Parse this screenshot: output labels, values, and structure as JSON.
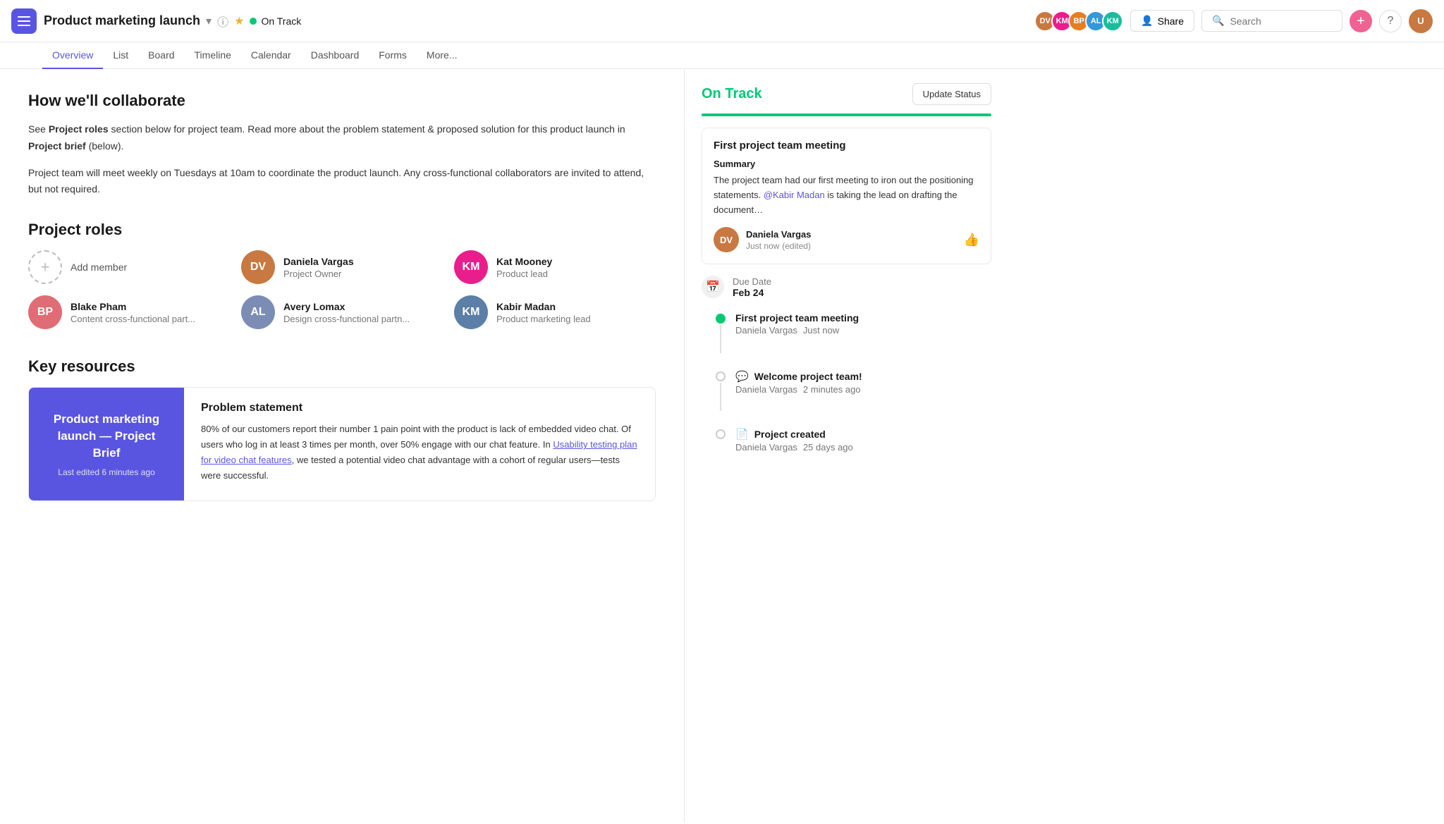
{
  "header": {
    "project_title": "Product marketing launch",
    "status_label": "On Track",
    "share_label": "Share",
    "search_placeholder": "Search",
    "help": "?"
  },
  "nav": {
    "tabs": [
      "Overview",
      "List",
      "Board",
      "Timeline",
      "Calendar",
      "Dashboard",
      "Forms",
      "More..."
    ],
    "active_tab": "Overview"
  },
  "main": {
    "collab_heading": "How we'll collaborate",
    "collab_para1_before": "See ",
    "collab_para1_bold1": "Project roles",
    "collab_para1_middle": " section below for project team. Read more about the problem statement & proposed solution for this product launch in ",
    "collab_para1_bold2": "Project brief",
    "collab_para1_after": " (below).",
    "collab_para2": "Project team will meet weekly on Tuesdays at 10am to coordinate the product launch. Any cross-functional collaborators are invited to attend, but not required.",
    "roles_heading": "Project roles",
    "add_member_label": "Add member",
    "roles": [
      {
        "name": "Daniela Vargas",
        "title": "Project Owner",
        "initials": "DV",
        "color": "av-brown"
      },
      {
        "name": "Kat Mooney",
        "title": "Product lead",
        "initials": "KM",
        "color": "av-pink"
      },
      {
        "name": "Blake Pham",
        "title": "Content cross-functional part...",
        "initials": "BP",
        "color": "av-orange"
      },
      {
        "name": "Avery Lomax",
        "title": "Design cross-functional partn...",
        "initials": "AL",
        "color": "av-blue"
      },
      {
        "name": "Kabir Madan",
        "title": "Product marketing lead",
        "initials": "KM2",
        "color": "av-teal"
      }
    ],
    "resources_heading": "Key resources",
    "resource_thumb_title": "Product marketing launch — Project Brief",
    "resource_thumb_sub": "Last edited 6 minutes ago",
    "problem_title": "Problem statement",
    "problem_text_before": "80% of our customers report their number 1 pain point with the product is lack of embedded video chat. Of users who log in at least 3 times per month, over 50% engage with our chat feature. In ",
    "problem_link": "Usability testing plan for video chat features",
    "problem_text_after": ", we tested a potential video chat advantage with a cohort of regular users—tests were successful."
  },
  "sidebar": {
    "status_label": "On Track",
    "update_status_label": "Update Status",
    "activity_card_title": "First project team meeting",
    "summary_label": "Summary",
    "summary_text_before": "The project team had our first meeting to iron out the positioning statements. ",
    "summary_mention": "@Kabir Madan",
    "summary_text_after": " is taking the lead on drafting the document…",
    "author_name": "Daniela Vargas",
    "author_time": "Just now",
    "author_edited": "(edited)",
    "due_label": "Due Date",
    "due_date": "Feb 24",
    "timeline_items": [
      {
        "type": "dot_green",
        "title": "First project team meeting",
        "author": "Daniela Vargas",
        "time": "Just now",
        "icon": "💬"
      },
      {
        "type": "dot_outline",
        "title": "Welcome project team!",
        "author": "Daniela Vargas",
        "time": "2 minutes ago",
        "icon": "💬"
      },
      {
        "type": "dot_outline",
        "title": "Project created",
        "author": "Daniela Vargas",
        "time": "25 days ago",
        "icon": "📄"
      }
    ]
  }
}
